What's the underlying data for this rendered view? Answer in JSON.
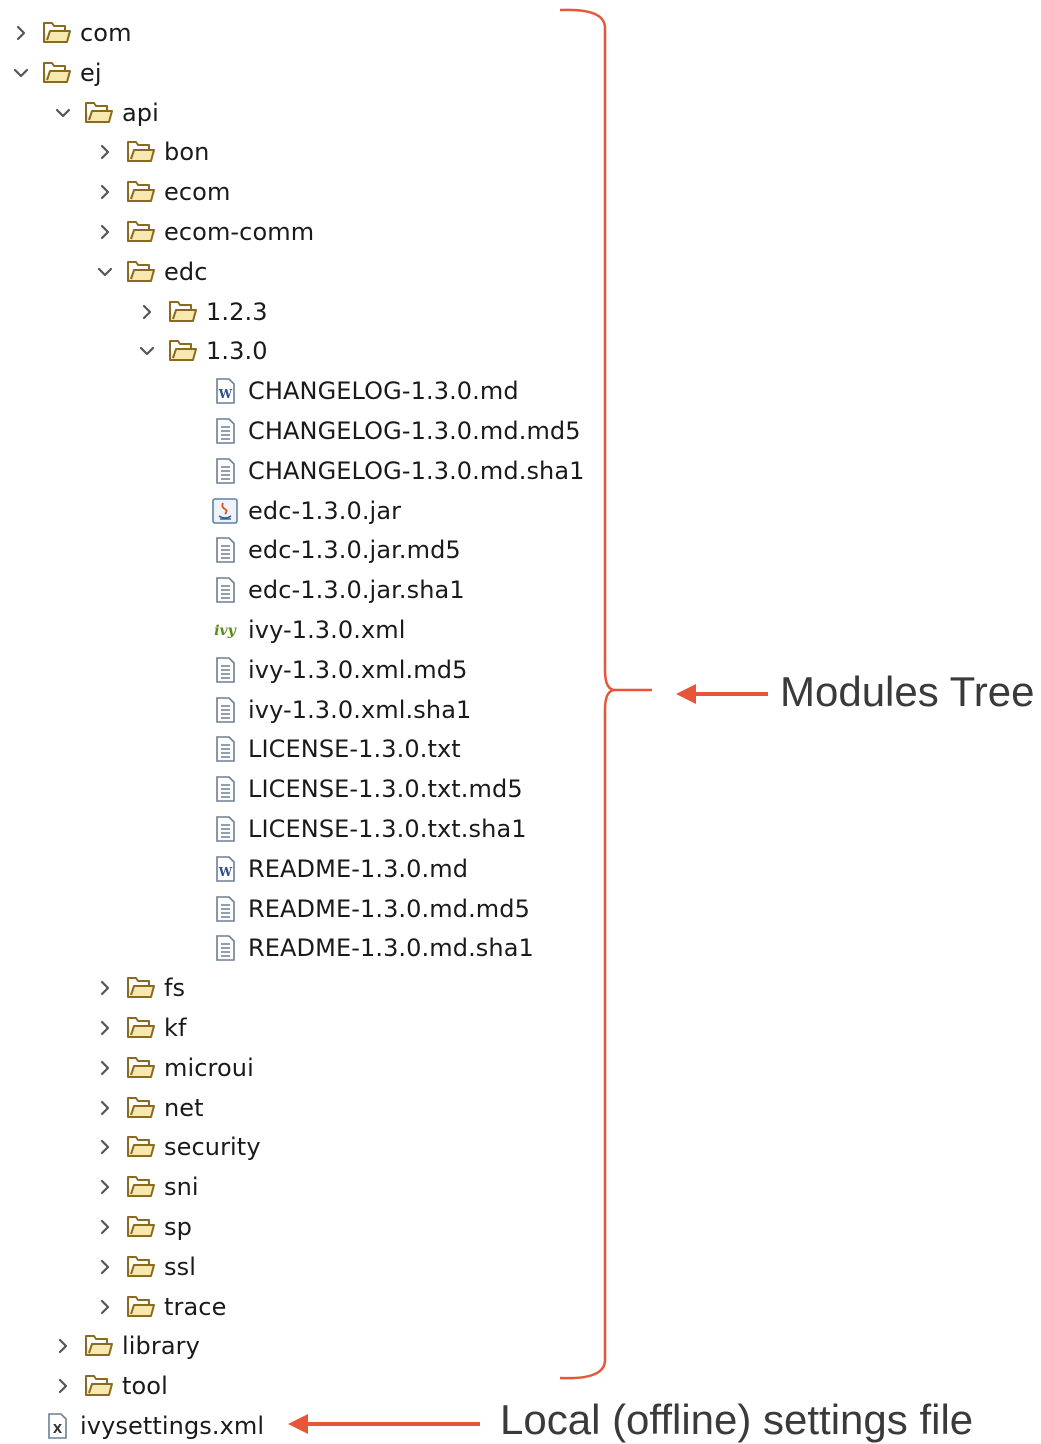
{
  "tree": [
    {
      "label": "com",
      "type": "folder",
      "state": "collapsed",
      "depth": 0,
      "icon": "folder-icon"
    },
    {
      "label": "ej",
      "type": "folder",
      "state": "expanded",
      "depth": 0,
      "icon": "folder-icon"
    },
    {
      "label": "api",
      "type": "folder",
      "state": "expanded",
      "depth": 1,
      "icon": "folder-icon"
    },
    {
      "label": "bon",
      "type": "folder",
      "state": "collapsed",
      "depth": 2,
      "icon": "folder-icon"
    },
    {
      "label": "ecom",
      "type": "folder",
      "state": "collapsed",
      "depth": 2,
      "icon": "folder-icon"
    },
    {
      "label": "ecom-comm",
      "type": "folder",
      "state": "collapsed",
      "depth": 2,
      "icon": "folder-icon"
    },
    {
      "label": "edc",
      "type": "folder",
      "state": "expanded",
      "depth": 2,
      "icon": "folder-icon"
    },
    {
      "label": "1.2.3",
      "type": "folder",
      "state": "collapsed",
      "depth": 3,
      "icon": "folder-icon"
    },
    {
      "label": "1.3.0",
      "type": "folder",
      "state": "expanded",
      "depth": 3,
      "icon": "folder-icon"
    },
    {
      "label": "CHANGELOG-1.3.0.md",
      "type": "file",
      "depth": 4,
      "icon": "word-doc-icon"
    },
    {
      "label": "CHANGELOG-1.3.0.md.md5",
      "type": "file",
      "depth": 4,
      "icon": "text-file-icon"
    },
    {
      "label": "CHANGELOG-1.3.0.md.sha1",
      "type": "file",
      "depth": 4,
      "icon": "text-file-icon"
    },
    {
      "label": "edc-1.3.0.jar",
      "type": "file",
      "depth": 4,
      "icon": "java-jar-icon"
    },
    {
      "label": "edc-1.3.0.jar.md5",
      "type": "file",
      "depth": 4,
      "icon": "text-file-icon"
    },
    {
      "label": "edc-1.3.0.jar.sha1",
      "type": "file",
      "depth": 4,
      "icon": "text-file-icon"
    },
    {
      "label": "ivy-1.3.0.xml",
      "type": "file",
      "depth": 4,
      "icon": "ivy-icon"
    },
    {
      "label": "ivy-1.3.0.xml.md5",
      "type": "file",
      "depth": 4,
      "icon": "text-file-icon"
    },
    {
      "label": "ivy-1.3.0.xml.sha1",
      "type": "file",
      "depth": 4,
      "icon": "text-file-icon"
    },
    {
      "label": "LICENSE-1.3.0.txt",
      "type": "file",
      "depth": 4,
      "icon": "text-file-icon"
    },
    {
      "label": "LICENSE-1.3.0.txt.md5",
      "type": "file",
      "depth": 4,
      "icon": "text-file-icon"
    },
    {
      "label": "LICENSE-1.3.0.txt.sha1",
      "type": "file",
      "depth": 4,
      "icon": "text-file-icon"
    },
    {
      "label": "README-1.3.0.md",
      "type": "file",
      "depth": 4,
      "icon": "word-doc-icon"
    },
    {
      "label": "README-1.3.0.md.md5",
      "type": "file",
      "depth": 4,
      "icon": "text-file-icon"
    },
    {
      "label": "README-1.3.0.md.sha1",
      "type": "file",
      "depth": 4,
      "icon": "text-file-icon"
    },
    {
      "label": "fs",
      "type": "folder",
      "state": "collapsed",
      "depth": 2,
      "icon": "folder-icon"
    },
    {
      "label": "kf",
      "type": "folder",
      "state": "collapsed",
      "depth": 2,
      "icon": "folder-icon"
    },
    {
      "label": "microui",
      "type": "folder",
      "state": "collapsed",
      "depth": 2,
      "icon": "folder-icon"
    },
    {
      "label": "net",
      "type": "folder",
      "state": "collapsed",
      "depth": 2,
      "icon": "folder-icon"
    },
    {
      "label": "security",
      "type": "folder",
      "state": "collapsed",
      "depth": 2,
      "icon": "folder-icon"
    },
    {
      "label": "sni",
      "type": "folder",
      "state": "collapsed",
      "depth": 2,
      "icon": "folder-icon"
    },
    {
      "label": "sp",
      "type": "folder",
      "state": "collapsed",
      "depth": 2,
      "icon": "folder-icon"
    },
    {
      "label": "ssl",
      "type": "folder",
      "state": "collapsed",
      "depth": 2,
      "icon": "folder-icon"
    },
    {
      "label": "trace",
      "type": "folder",
      "state": "collapsed",
      "depth": 2,
      "icon": "folder-icon"
    },
    {
      "label": "library",
      "type": "folder",
      "state": "collapsed",
      "depth": 1,
      "icon": "folder-icon"
    },
    {
      "label": "tool",
      "type": "folder",
      "state": "collapsed",
      "depth": 1,
      "icon": "folder-icon"
    },
    {
      "label": "ivysettings.xml",
      "type": "file",
      "depth": 0,
      "icon": "xml-file-icon"
    }
  ],
  "annotations": {
    "modules_tree": "Modules Tree",
    "settings_file": "Local (offline) settings file"
  },
  "colors": {
    "arrow": "#e8563a",
    "folder_stroke": "#8a6a1e",
    "folder_fill": "#f7e8b0",
    "chevron": "#555555",
    "ivy_green": "#5a8a1a"
  }
}
